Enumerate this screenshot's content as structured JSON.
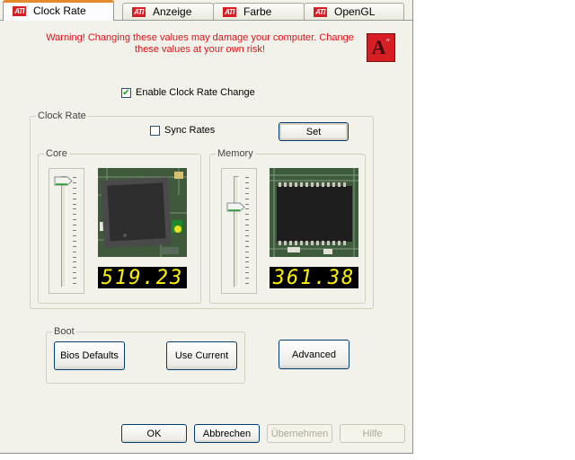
{
  "tabs": [
    {
      "label": "Clock Rate",
      "logo": "ATI",
      "active": true
    },
    {
      "label": "Anzeige",
      "logo": "ATI",
      "active": false
    },
    {
      "label": "Farbe",
      "logo": "ATI",
      "active": false
    },
    {
      "label": "OpenGL",
      "logo": "ATI",
      "active": false
    }
  ],
  "warning": {
    "line1": "Warning!  Changing these values may damage your computer.  Change",
    "line2": "these values at your own risk!"
  },
  "badge": {
    "letter": "A",
    "icon": "ati-a-logo-icon"
  },
  "enable_clock": {
    "label": "Enable Clock Rate Change",
    "checked": true
  },
  "clock_rate": {
    "title": "Clock Rate",
    "sync_rates": {
      "label": "Sync Rates",
      "checked": false
    },
    "set_label": "Set",
    "core": {
      "title": "Core",
      "value": "519.23",
      "slider_level": 0.97
    },
    "memory": {
      "title": "Memory",
      "value": "361.38",
      "slider_level": 0.72
    }
  },
  "boot": {
    "title": "Boot",
    "bios_defaults": "Bios Defaults",
    "use_current": "Use Current"
  },
  "advanced_label": "Advanced",
  "footer": {
    "ok": "OK",
    "cancel": "Abbrechen",
    "apply": "Übernehmen",
    "help": "Hilfe"
  },
  "colors": {
    "warning": "#e1131a",
    "lcd_text": "#fff200",
    "ati_red": "#d61e24",
    "tab_highlight": "#e68b2c"
  }
}
